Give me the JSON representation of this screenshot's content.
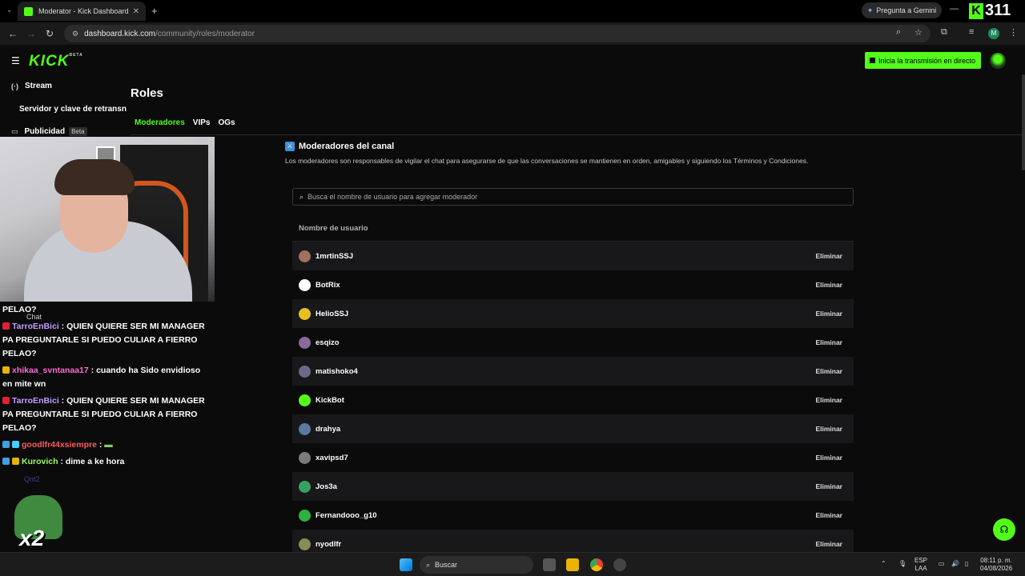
{
  "browser": {
    "tab_title": "Moderator - Kick Dashboard",
    "gemini_label": "Pregunta a Gemini",
    "overlay_count": "311",
    "url_host": "dashboard.kick.com",
    "url_path": "/community/roles/moderator",
    "profile_initial": "M"
  },
  "app": {
    "logo": "KICK",
    "logo_sup": "BETA",
    "go_live_label": "Inicia la transmisión en directo",
    "accent": "#53fc18"
  },
  "sidebar": {
    "items": [
      {
        "label": "Stream",
        "icon": "broadcast-icon"
      },
      {
        "label": "Servidor y clave de retransn"
      },
      {
        "label": "Publicidad",
        "icon": "ad-icon",
        "badge": "Beta"
      }
    ]
  },
  "page": {
    "title": "Roles",
    "tabs": [
      "Moderadores",
      "VIPs",
      "OGs"
    ],
    "active_tab": "Moderadores"
  },
  "section": {
    "title": "Moderadores del canal",
    "description": "Los moderadores son responsables de vigilar el chat para asegurarse de que las conversaciones se mantienen en orden, amigables y siguiendo los Términos y Condiciones.",
    "search_placeholder": "Busca el nombre de usuario para agregar moderador",
    "column_header": "Nombre de usuario",
    "remove_label": "Eliminar",
    "moderators": [
      {
        "name": "1mrtinSSJ",
        "color": "#a07060"
      },
      {
        "name": "BotRix",
        "color": "#ffffff"
      },
      {
        "name": "HelioSSJ",
        "color": "#e6c020"
      },
      {
        "name": "esqizo",
        "color": "#8a6a9a"
      },
      {
        "name": "matishoko4",
        "color": "#6a6a8a"
      },
      {
        "name": "KickBot",
        "color": "#53fc18"
      },
      {
        "name": "drahya",
        "color": "#5a7aa0"
      },
      {
        "name": "xavipsd7",
        "color": "#7a7a7a"
      },
      {
        "name": "Jos3a",
        "color": "#3aa060"
      },
      {
        "name": "Fernandooo_g10",
        "color": "#30b040"
      },
      {
        "name": "nyodlfr",
        "color": "#8a8a5a"
      }
    ]
  },
  "chat": {
    "label": "Chat",
    "lines": [
      {
        "text": "PELAO?"
      },
      {
        "user": "TarroEnBici",
        "text": ": QUIEN QUIERE SER MI MANAGER PA PREGUNTARLE SI PUEDO CULIAR A FIERRO PELAO?"
      },
      {
        "user": "xhikaa_svntanaa17",
        "text": ": cuando ha Sido envidioso en mite wn"
      },
      {
        "user": "TarroEnBici",
        "text": ": QUIEN QUIERE SER MI MANAGER PA PREGUNTARLE SI PUEDO CULIAR A FIERRO PELAO?"
      },
      {
        "user": "goodlfr44xsiempre",
        "text": ":"
      },
      {
        "user": "Kurovich",
        "text": ": dime a ke hora"
      }
    ],
    "ghost_user": "Qnt2",
    "combo": "x2"
  },
  "taskbar": {
    "search_label": "Buscar",
    "lang_top": "ESP",
    "lang_bottom": "LAA",
    "time": "08:11 p. m.",
    "date": "04/08/2026"
  }
}
